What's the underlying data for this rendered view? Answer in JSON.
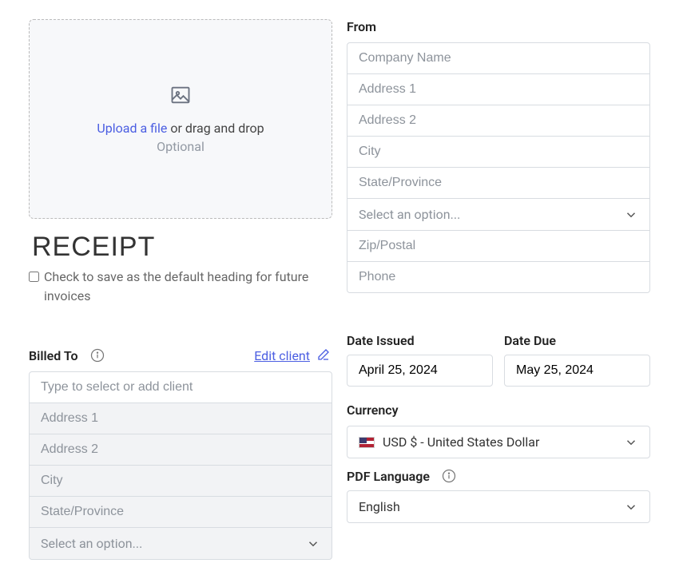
{
  "upload": {
    "link_text": "Upload a file",
    "or_text": " or drag and drop",
    "optional": "Optional"
  },
  "heading_value": "RECEIPT",
  "save_heading_label": "Check to save as the default heading for future invoices",
  "from": {
    "label": "From",
    "company_ph": "Company Name",
    "addr1_ph": "Address 1",
    "addr2_ph": "Address 2",
    "city_ph": "City",
    "state_ph": "State/Province",
    "country_ph": "Select an option...",
    "zip_ph": "Zip/Postal",
    "phone_ph": "Phone"
  },
  "billed": {
    "label": "Billed To",
    "edit_text": "Edit client",
    "client_ph": "Type to select or add client",
    "addr1_ph": "Address 1",
    "addr2_ph": "Address 2",
    "city_ph": "City",
    "state_ph": "State/Province",
    "country_ph": "Select an option..."
  },
  "dates": {
    "issued_label": "Date Issued",
    "issued_value": "April 25, 2024",
    "due_label": "Date Due",
    "due_value": "May 25, 2024"
  },
  "currency": {
    "label": "Currency",
    "value": "USD $ - United States Dollar"
  },
  "pdf_lang": {
    "label": "PDF Language",
    "value": "English"
  }
}
